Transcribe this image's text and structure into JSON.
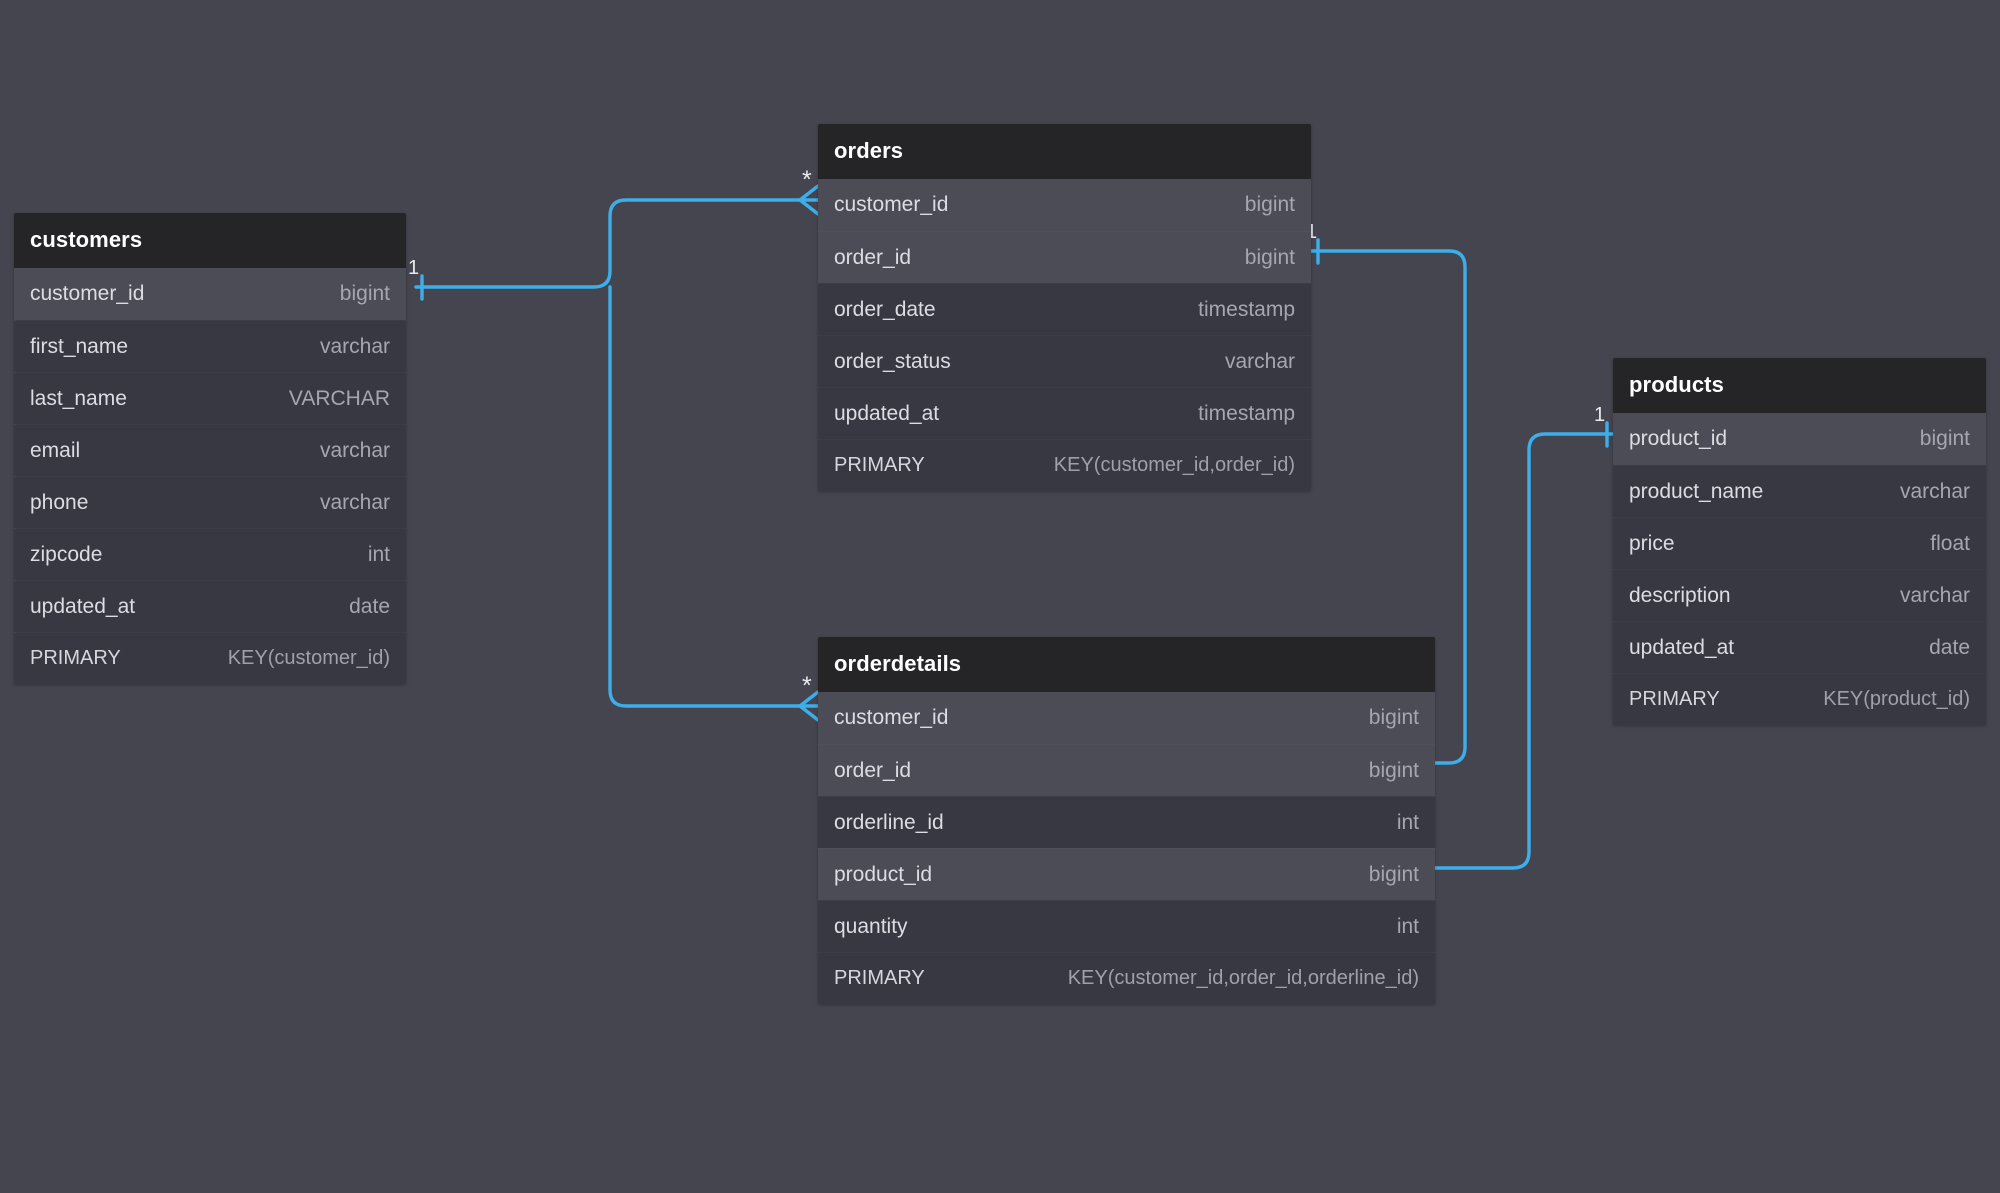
{
  "diagram": {
    "type": "entity-relationship-diagram",
    "background_color": "#454550",
    "accent_color": "#3daee9",
    "header_color": "#252528",
    "row_color": "#383843",
    "row_highlight_color": "#4c4c57"
  },
  "tables": [
    {
      "name": "customers",
      "columns": [
        {
          "name": "customer_id",
          "type": "bigint",
          "key": true
        },
        {
          "name": "first_name",
          "type": "varchar",
          "key": false
        },
        {
          "name": "last_name",
          "type": "VARCHAR",
          "key": false
        },
        {
          "name": "email",
          "type": "varchar",
          "key": false
        },
        {
          "name": "phone",
          "type": "varchar",
          "key": false
        },
        {
          "name": "zipcode",
          "type": "int",
          "key": false
        },
        {
          "name": "updated_at",
          "type": "date",
          "key": false
        },
        {
          "name": "PRIMARY",
          "type": "KEY(customer_id)",
          "key": false
        }
      ]
    },
    {
      "name": "orders",
      "columns": [
        {
          "name": "customer_id",
          "type": "bigint",
          "key": true
        },
        {
          "name": "order_id",
          "type": "bigint",
          "key": true
        },
        {
          "name": "order_date",
          "type": "timestamp",
          "key": false
        },
        {
          "name": "order_status",
          "type": "varchar",
          "key": false
        },
        {
          "name": "updated_at",
          "type": "timestamp",
          "key": false
        },
        {
          "name": "PRIMARY",
          "type": "KEY(customer_id,order_id)",
          "key": false
        }
      ]
    },
    {
      "name": "orderdetails",
      "columns": [
        {
          "name": "customer_id",
          "type": "bigint",
          "key": true
        },
        {
          "name": "order_id",
          "type": "bigint",
          "key": true
        },
        {
          "name": "orderline_id",
          "type": "int",
          "key": false
        },
        {
          "name": "product_id",
          "type": "bigint",
          "key": true
        },
        {
          "name": "quantity",
          "type": "int",
          "key": false
        },
        {
          "name": "PRIMARY",
          "type": "KEY(customer_id,order_id,orderline_id)",
          "key": false
        }
      ]
    },
    {
      "name": "products",
      "columns": [
        {
          "name": "product_id",
          "type": "bigint",
          "key": true
        },
        {
          "name": "product_name",
          "type": "varchar",
          "key": false
        },
        {
          "name": "price",
          "type": "float",
          "key": false
        },
        {
          "name": "description",
          "type": "varchar",
          "key": false
        },
        {
          "name": "updated_at",
          "type": "date",
          "key": false
        },
        {
          "name": "PRIMARY",
          "type": "KEY(product_id)",
          "key": false
        }
      ]
    }
  ],
  "relationships": [
    {
      "from_table": "customers",
      "from_column": "customer_id",
      "to_table": "orders",
      "to_column": "customer_id",
      "from_cardinality": "1",
      "to_cardinality": "*"
    },
    {
      "from_table": "customers",
      "from_column": "customer_id",
      "to_table": "orderdetails",
      "to_column": "customer_id",
      "from_cardinality": "1",
      "to_cardinality": "*"
    },
    {
      "from_table": "orders",
      "from_column": "order_id",
      "to_table": "orderdetails",
      "to_column": "order_id",
      "from_cardinality": "1",
      "to_cardinality": "*"
    },
    {
      "from_table": "products",
      "from_column": "product_id",
      "to_table": "orderdetails",
      "to_column": "product_id",
      "from_cardinality": "1",
      "to_cardinality": "*"
    }
  ],
  "cardinality_markers": [
    {
      "label": "1",
      "for": "customers.customer_id"
    },
    {
      "label": "*",
      "for": "orders.customer_id"
    },
    {
      "label": "*",
      "for": "orderdetails.customer_id"
    },
    {
      "label": "1",
      "for": "orders.order_id"
    },
    {
      "label": "*",
      "for": "orderdetails.order_id"
    },
    {
      "label": "1",
      "for": "products.product_id"
    },
    {
      "label": "*",
      "for": "orderdetails.product_id"
    }
  ]
}
